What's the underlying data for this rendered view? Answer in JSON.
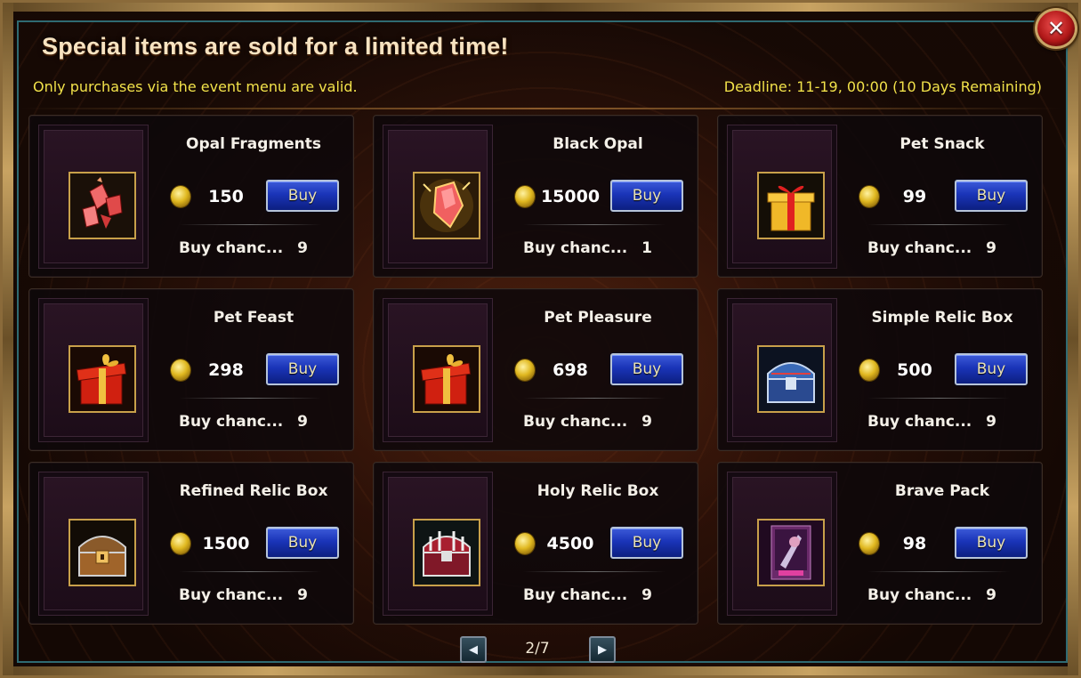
{
  "window": {
    "title": "Special items are sold for a limited time!",
    "subtitle": "Only purchases via the event menu are valid.",
    "deadline": "Deadline: 11-19, 00:00 (10 Days Remaining)",
    "close_icon": "close-icon"
  },
  "currency_icon": "gold-coin-icon",
  "buy_label": "Buy",
  "chance_label": "Buy chanc...",
  "items": [
    {
      "name": "Opal Fragments",
      "price": "150",
      "chance": "9",
      "icon": "opal-fragments-icon"
    },
    {
      "name": "Black Opal",
      "price": "15000",
      "chance": "1",
      "icon": "black-opal-icon"
    },
    {
      "name": "Pet Snack",
      "price": "99",
      "chance": "9",
      "icon": "gift-box-icon"
    },
    {
      "name": "Pet Feast",
      "price": "298",
      "chance": "9",
      "icon": "gift-box-red-icon"
    },
    {
      "name": "Pet Pleasure",
      "price": "698",
      "chance": "9",
      "icon": "gift-box-red-icon"
    },
    {
      "name": "Simple Relic Box",
      "price": "500",
      "chance": "9",
      "icon": "blue-chest-icon"
    },
    {
      "name": "Refined Relic Box",
      "price": "1500",
      "chance": "9",
      "icon": "gold-chest-icon"
    },
    {
      "name": "Holy Relic Box",
      "price": "4500",
      "chance": "9",
      "icon": "red-chest-icon"
    },
    {
      "name": "Brave Pack",
      "price": "98",
      "chance": "9",
      "icon": "brave-pack-card-icon"
    }
  ],
  "pagination": {
    "text": "2/7",
    "prev_icon": "arrow-left-icon",
    "next_icon": "arrow-right-icon"
  },
  "colors": {
    "accent_yellow": "#f2e24a",
    "button_blue": "#1a34b8",
    "frame_gold": "#b08a4a"
  }
}
